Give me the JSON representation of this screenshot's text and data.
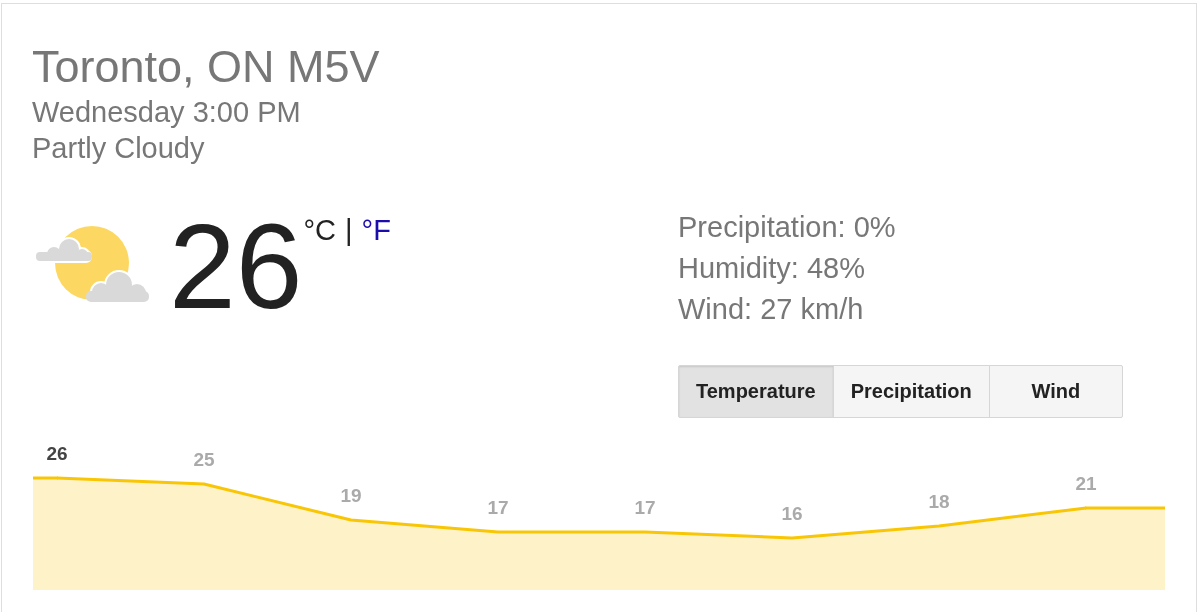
{
  "location": {
    "title": "Toronto, ON M5V",
    "time": "Wednesday 3:00 PM",
    "condition": "Partly Cloudy"
  },
  "current": {
    "temperature": "26",
    "units": [
      {
        "label": "°C",
        "selected": true
      },
      {
        "label": "°F",
        "selected": false
      }
    ],
    "separator": "|"
  },
  "details": [
    "Precipitation: 0%",
    "Humidity: 48%",
    "Wind: 27 km/h"
  ],
  "chart_tabs": [
    {
      "label": "Temperature",
      "selected": true
    },
    {
      "label": "Precipitation",
      "selected": false
    },
    {
      "label": "Wind",
      "selected": false
    }
  ],
  "forecast": {
    "points": [
      {
        "selected": true
      },
      {
        "selected": false
      },
      {
        "selected": false
      },
      {
        "selected": false
      },
      {
        "selected": false
      },
      {
        "selected": false
      },
      {
        "selected": false
      },
      {
        "selected": false
      }
    ],
    "chart_data": {
      "type": "area",
      "categories": [
        null,
        null,
        null,
        null,
        null,
        null,
        null,
        null
      ],
      "data_labels": true,
      "series": [
        {
          "color": "#f9c606",
          "values": [
            26,
            25,
            19,
            17,
            17,
            16,
            18,
            21
          ]
        }
      ]
    }
  }
}
